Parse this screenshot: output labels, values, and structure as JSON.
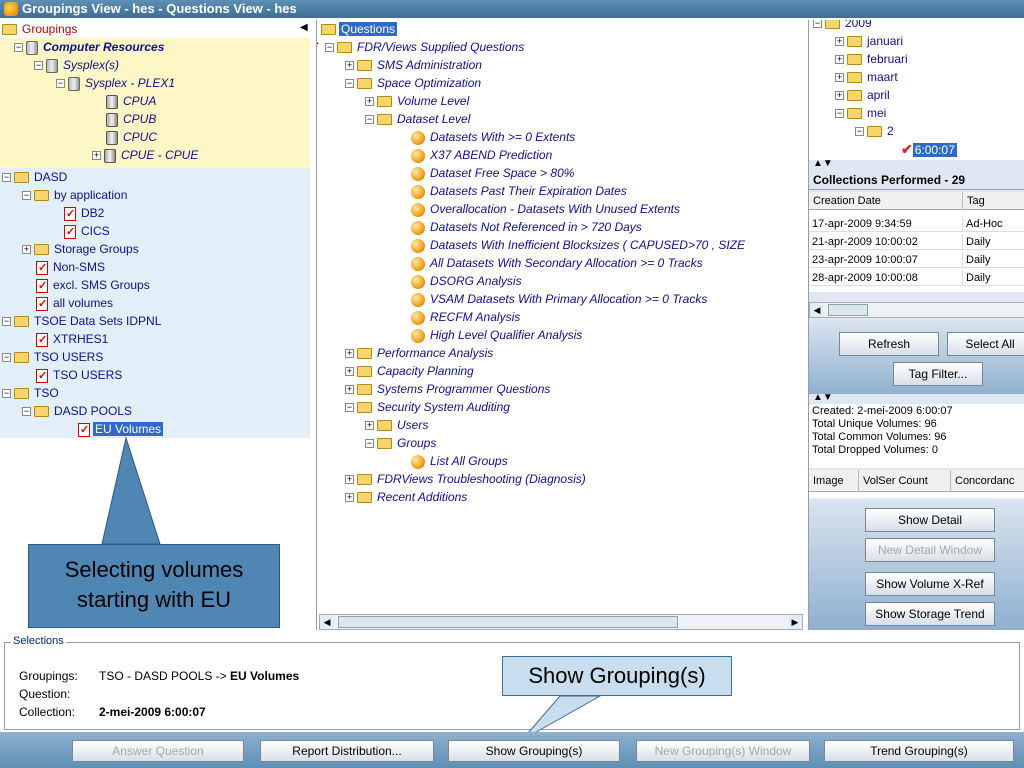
{
  "window": {
    "title": "Groupings View - hes  - Questions View - hes"
  },
  "groupings_tree": {
    "root": "Groupings",
    "computer_resources": "Computer Resources",
    "sysplexes": "Sysplex(s)",
    "sysplex": "Sysplex - PLEX1",
    "cpus": [
      "CPUA",
      "CPUB",
      "CPUC",
      "CPUE - CPUE"
    ],
    "dasd": "DASD",
    "by_application": "by application",
    "apps": [
      "DB2",
      "CICS"
    ],
    "storage_groups": "Storage Groups",
    "non_sms": "Non-SMS",
    "excl_sms": "excl. SMS Groups",
    "all_volumes": "all volumes",
    "tsoe": "TSOE Data Sets IDPNL",
    "xtrhes": "XTRHES1",
    "tso_users": "TSO USERS",
    "tso_users_item": "TSO USERS",
    "tso": "TSO",
    "dasd_pools": "DASD POOLS",
    "eu_volumes": "EU Volumes"
  },
  "callouts": {
    "selecting_volumes": "Selecting volumes starting with EU",
    "show_groupings": "Show Grouping(s)"
  },
  "questions_tree": {
    "root": "Questions",
    "fdr_supplied": "FDR/Views Supplied Questions",
    "sms_admin": "SMS Administration",
    "space_opt": "Space Optimization",
    "volume_level": "Volume Level",
    "dataset_level": "Dataset Level",
    "dataset_questions": [
      "Datasets With >= 0 Extents",
      "X37 ABEND Prediction",
      "Dataset Free Space > 80%",
      "Datasets Past Their Expiration Dates",
      "Overallocation - Datasets With Unused Extents",
      "Datasets Not Referenced in > 720 Days",
      "Datasets With Inefficient Blocksizes ( CAPUSED>70 , SIZE",
      "All Datasets With Secondary Allocation >= 0 Tracks",
      "DSORG Analysis",
      "VSAM Datasets With Primary Allocation >= 0 Tracks",
      "RECFM Analysis",
      "High Level Qualifier Analysis"
    ],
    "performance": "Performance Analysis",
    "capacity": "Capacity Planning",
    "sysprog": "Systems Programmer Questions",
    "security": "Security System Auditing",
    "users": "Users",
    "groups": "Groups",
    "list_groups": "List All Groups",
    "troubleshooting": "FDRViews Troubleshooting (Diagnosis)",
    "recent": "Recent Additions"
  },
  "date_tree": {
    "year": "2009",
    "months": [
      "januari",
      "februari",
      "maart",
      "april",
      "mei"
    ],
    "day": "2",
    "time": "6:00:07"
  },
  "collections": {
    "header": "Collections Performed - 29",
    "columns": [
      "Creation Date",
      "Tag"
    ],
    "rows": [
      [
        "17-apr-2009 9:34:59",
        "Ad-Hoc"
      ],
      [
        "21-apr-2009 10:00:02",
        "Daily"
      ],
      [
        "23-apr-2009 10:00:07",
        "Daily"
      ],
      [
        "28-apr-2009 10:00:08",
        "Daily"
      ]
    ],
    "refresh_button": "Refresh",
    "select_all_button": "Select All",
    "tag_filter_button": "Tag Filter..."
  },
  "collection_info": {
    "created": "Created: 2-mei-2009 6:00:07",
    "unique": "Total Unique Volumes: 96",
    "common": "Total Common Volumes: 96",
    "dropped": "Total Dropped Volumes: 0",
    "columns": [
      "Image",
      "VolSer Count",
      "Concordanc"
    ]
  },
  "detail_buttons": {
    "show_detail": "Show Detail",
    "new_detail_window": "New Detail Window",
    "show_volume_xref": "Show Volume X-Ref",
    "show_storage_trend": "Show Storage Trend"
  },
  "selections": {
    "legend": "Selections",
    "groupings_key": "Groupings:",
    "groupings_value_prefix": "TSO - DASD POOLS -> ",
    "groupings_value_bold": "EU Volumes",
    "question_key": "Question:",
    "collection_key": "Collection:",
    "collection_value": "2-mei-2009 6:00:07"
  },
  "bottom_buttons": {
    "answer_question": "Answer Question",
    "report_distribution": "Report Distribution...",
    "show_groupings": "Show Grouping(s)",
    "new_groupings_window": "New Grouping(s) Window",
    "trend_groupings": "Trend Grouping(s)"
  }
}
